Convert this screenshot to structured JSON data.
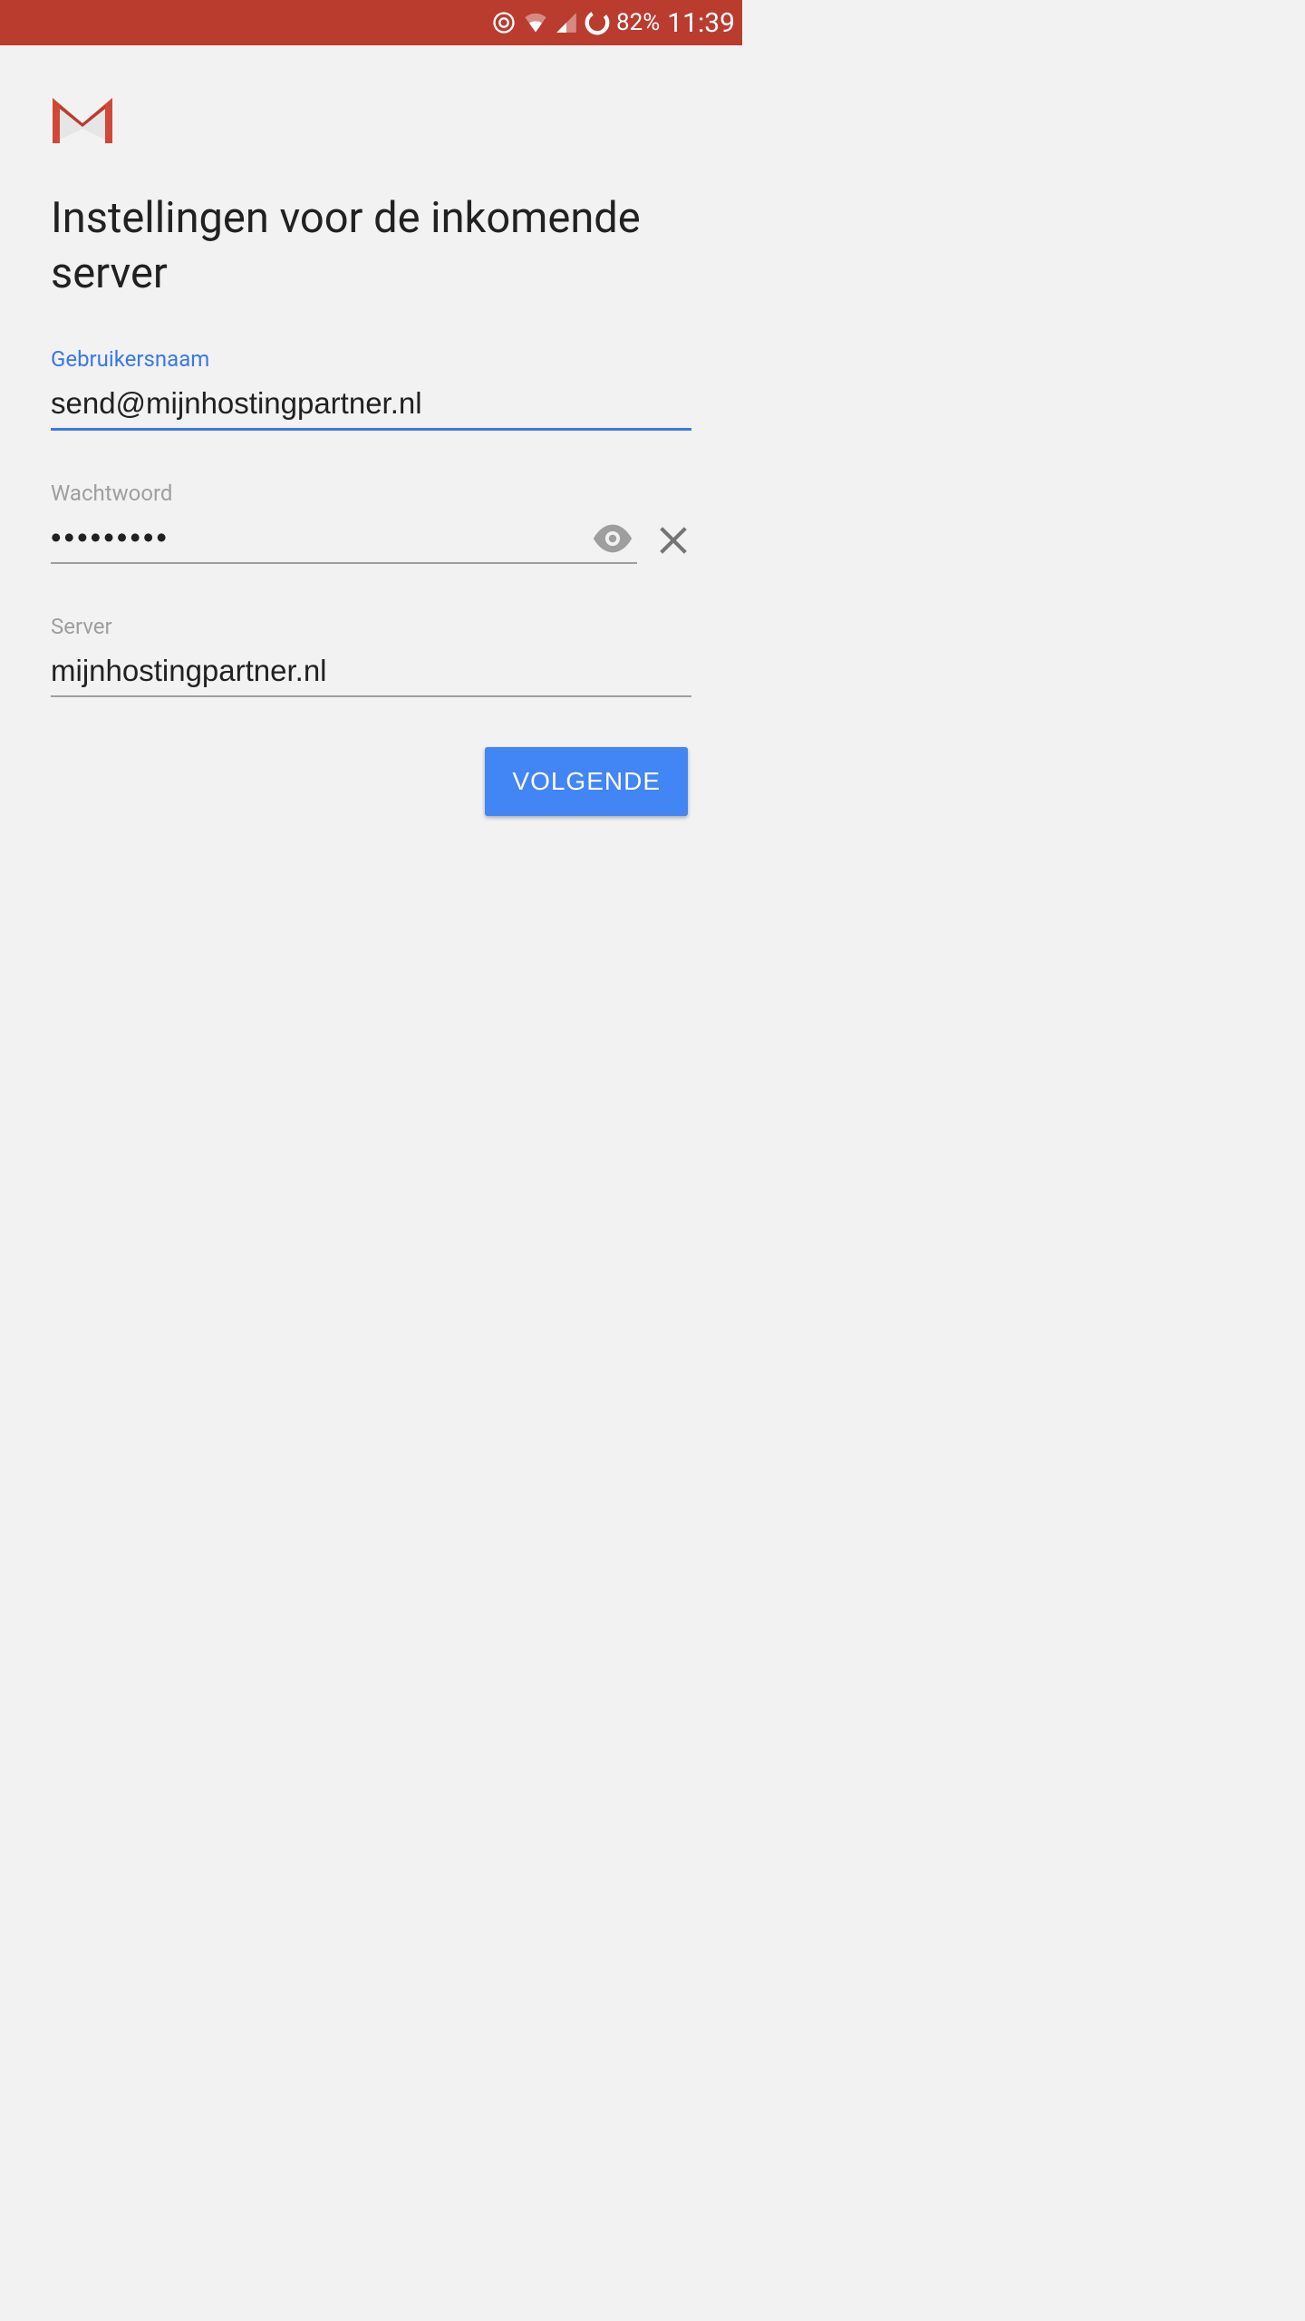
{
  "status_bar": {
    "battery_pct": "82%",
    "time": "11:39"
  },
  "page": {
    "title": "Instellingen voor de inkomende server"
  },
  "fields": {
    "username": {
      "label": "Gebruikersnaam",
      "value": "send@mijnhostingpartner.nl"
    },
    "password": {
      "label": "Wachtwoord",
      "value": "•••••••••"
    },
    "server": {
      "label": "Server",
      "value": "mijnhostingpartner.nl"
    }
  },
  "actions": {
    "next_label": "VOLGENDE"
  }
}
